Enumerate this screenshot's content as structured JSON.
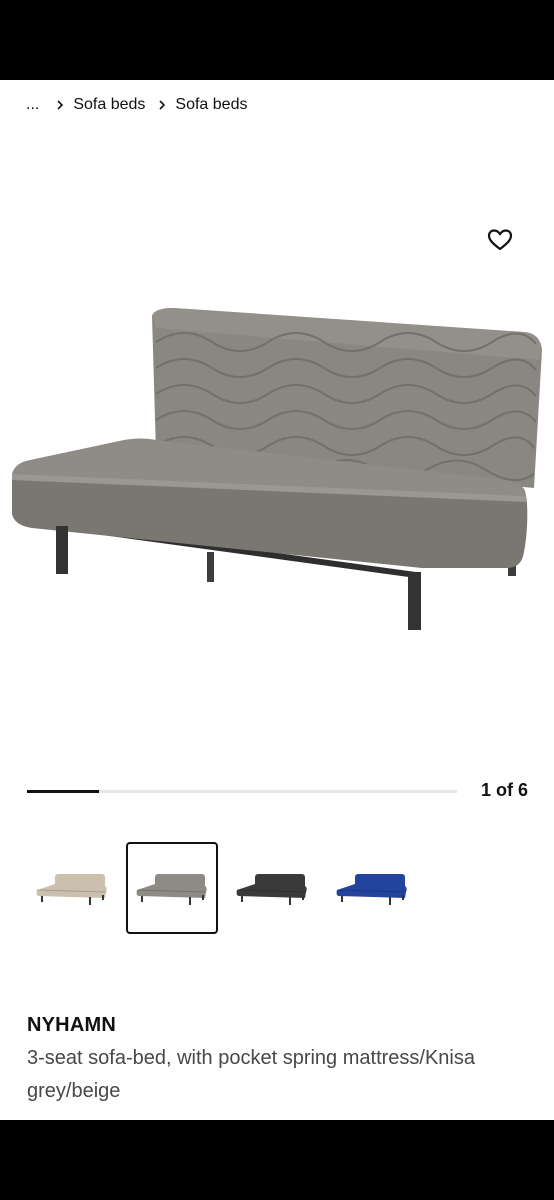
{
  "breadcrumb": {
    "ellipsis": "...",
    "items": [
      "Sofa beds",
      "Sofa beds"
    ]
  },
  "icons": {
    "chevron": "chevron-right-icon",
    "favourite": "heart-icon"
  },
  "gallery": {
    "current": 1,
    "total": 6,
    "counter_text": "1 of 6",
    "progress_fraction": 0.167
  },
  "variants": [
    {
      "name": "beige",
      "color": "#cbbfae",
      "selected": false
    },
    {
      "name": "grey/beige",
      "color": "#8e8b86",
      "selected": true
    },
    {
      "name": "dark grey",
      "color": "#3a3a3a",
      "selected": false
    },
    {
      "name": "blue",
      "color": "#23449c",
      "selected": false
    }
  ],
  "product": {
    "name": "NYHAMN",
    "description": "3-seat sofa-bed, with pocket spring mattress/Knisa grey/beige",
    "upholstery_color": "#8e8b86"
  }
}
